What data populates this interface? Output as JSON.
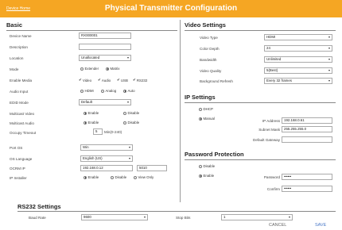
{
  "header": {
    "back_link": "Device Home",
    "title": "Physical Transmitter Configuration"
  },
  "basic": {
    "title": "Basic",
    "device_name_label": "Device Name",
    "device_name_value": "RX000001",
    "description_label": "Description",
    "description_value": "",
    "location_label": "Location",
    "location_value": "Unallocated",
    "mode_label": "Mode",
    "mode_options": [
      "Extender",
      "Matrix"
    ],
    "enable_media_label": "Enable Media",
    "media_options": [
      "Video",
      "Audio",
      "USB",
      "RS232"
    ],
    "audio_input_label": "Audio Input",
    "audio_input_options": [
      "HDMI",
      "Analog",
      "Auto"
    ],
    "edid_mode_label": "EDID Mode",
    "edid_mode_value": "Default",
    "multicast_video_label": "Multicast Video",
    "multicast_video_options": [
      "Enable",
      "Disable"
    ],
    "multicast_audio_label": "Multicast Audio",
    "multicast_audio_options": [
      "Enable",
      "Disable"
    ],
    "occupy_timeout_label": "Occupy Timeout",
    "occupy_timeout_value": "5",
    "occupy_timeout_unit": "Min(0-240)",
    "port_os_label": "Port OS",
    "port_os_value": "Win",
    "os_language_label": "OS Language",
    "os_language_value": "English (US)",
    "ocrm_ip_label": "OCRM IP",
    "ocrm_ip_value": "192.168.0.12",
    "ocrm_port_value": "5010",
    "ip_installer_label": "IP Installer",
    "ip_installer_options": [
      "Enable",
      "Disable",
      "View Only"
    ]
  },
  "video": {
    "title": "Video Settings",
    "video_type_label": "Video Type",
    "video_type_value": "HDMI",
    "color_depth_label": "Color Depth",
    "color_depth_value": "24",
    "bandwidth_label": "Bandwidth",
    "bandwidth_value": "Unlimited",
    "video_quality_label": "Video Quality",
    "video_quality_value": "5(Best)",
    "bg_refresh_label": "Background Refresh",
    "bg_refresh_value": "Every 32 frames"
  },
  "ip": {
    "title": "IP Settings",
    "dhcp_label": "DHCP",
    "manual_label": "Manual",
    "ip_address_label": "IP Address",
    "ip_address_value": "192.168.0.61",
    "subnet_label": "Subnet Mask",
    "subnet_value": "255.255.255.0",
    "gateway_label": "Default Gateway",
    "gateway_value": ""
  },
  "password": {
    "title": "Password Protection",
    "disable_label": "Disable",
    "enable_label": "Enable",
    "password_label": "Password",
    "password_value": "••••••",
    "confirm_label": "Confirm",
    "confirm_value": "••••••"
  },
  "rs232": {
    "title": "RS232 Settings",
    "baud_rate_label": "Baud Rate",
    "baud_rate_value": "9600",
    "stop_bits_label": "Stop Bits",
    "stop_bits_value": "1"
  },
  "footer": {
    "cancel": "CANCEL",
    "save": "SAVE"
  },
  "colors": {
    "header": "#f5a623",
    "save": "#4a78c8"
  },
  "icons": {
    "dropdown": "chevron-down-icon",
    "checkbox": "checkbox-checked-icon",
    "radio": "radio-icon"
  }
}
